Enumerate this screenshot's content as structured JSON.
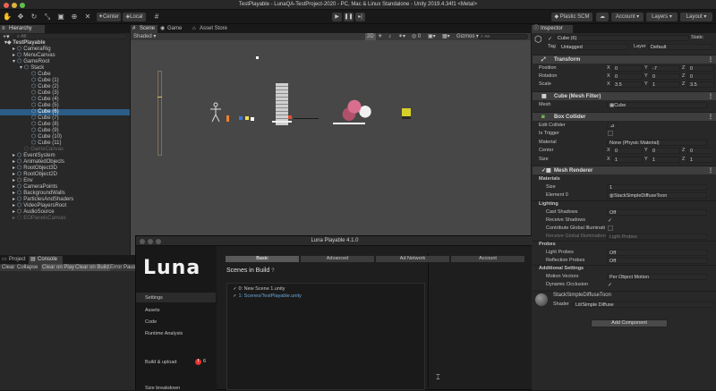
{
  "window": {
    "title": "TestPlayable - LunaQA-TestProject-2020 - PC, Mac & Linux Standalone - Unity 2019.4.34f1 <Metal>"
  },
  "toolbar": {
    "pivot_label": "Center",
    "space_label": "Local",
    "plastic_label": "Plastic SCM",
    "account_label": "Account",
    "layers_label": "Layers",
    "layout_label": "Layout"
  },
  "hierarchy": {
    "tab_label": "Hierarchy",
    "search_placeholder": "All",
    "root": "TestPlayable",
    "items": [
      {
        "label": "CameraRig",
        "indent": 1,
        "state": "normal"
      },
      {
        "label": "MenuCanvas",
        "indent": 1,
        "state": "normal"
      },
      {
        "label": "GameRoot",
        "indent": 1,
        "state": "normal"
      },
      {
        "label": "Stack",
        "indent": 2,
        "state": "normal"
      },
      {
        "label": "Cube",
        "indent": 3,
        "state": "normal"
      },
      {
        "label": "Cube (1)",
        "indent": 3,
        "state": "normal"
      },
      {
        "label": "Cube (2)",
        "indent": 3,
        "state": "normal"
      },
      {
        "label": "Cube (3)",
        "indent": 3,
        "state": "normal"
      },
      {
        "label": "Cube (4)",
        "indent": 3,
        "state": "normal"
      },
      {
        "label": "Cube (5)",
        "indent": 3,
        "state": "normal"
      },
      {
        "label": "Cube (6)",
        "indent": 3,
        "state": "selected"
      },
      {
        "label": "Cube (7)",
        "indent": 3,
        "state": "normal"
      },
      {
        "label": "Cube (8)",
        "indent": 3,
        "state": "normal"
      },
      {
        "label": "Cube (9)",
        "indent": 3,
        "state": "normal"
      },
      {
        "label": "Cube (10)",
        "indent": 3,
        "state": "normal"
      },
      {
        "label": "Cube (11)",
        "indent": 3,
        "state": "normal"
      },
      {
        "label": "GameCanvas",
        "indent": 2,
        "state": "dim"
      },
      {
        "label": "EventSystem",
        "indent": 1,
        "state": "normal"
      },
      {
        "label": "AnimatedObjects",
        "indent": 1,
        "state": "normal"
      },
      {
        "label": "RootObject3D",
        "indent": 1,
        "state": "normal"
      },
      {
        "label": "RootObject2D",
        "indent": 1,
        "state": "normal"
      },
      {
        "label": "Env",
        "indent": 1,
        "state": "normal"
      },
      {
        "label": "CameraPoints",
        "indent": 1,
        "state": "normal"
      },
      {
        "label": "BackgroundWalls",
        "indent": 1,
        "state": "normal"
      },
      {
        "label": "ParticlesAndShaders",
        "indent": 1,
        "state": "normal"
      },
      {
        "label": "VideoPlayersRoot",
        "indent": 1,
        "state": "normal"
      },
      {
        "label": "AudioSource",
        "indent": 1,
        "state": "normal"
      },
      {
        "label": "EOPanelsCanvas",
        "indent": 1,
        "state": "dim"
      }
    ]
  },
  "scene": {
    "tabs": [
      "Scene",
      "Game",
      "Asset Store"
    ],
    "shading": "Shaded",
    "mode": "2D",
    "gizmos": "Gizmos",
    "search_placeholder": "All"
  },
  "console": {
    "tabs": [
      "Project",
      "Console"
    ],
    "buttons": [
      "Clear",
      "Collapse",
      "Clear on Play",
      "Clear on Build",
      "Error Pause"
    ]
  },
  "luna": {
    "title": "Luna Playable 4.1.0",
    "logo": "Luna",
    "tabs": [
      "Basic",
      "Advanced",
      "Ad Network",
      "Account"
    ],
    "nav": [
      "Settings",
      "Assets",
      "Code",
      "Runtime Analysis",
      "Build & upload",
      "Size breakdown"
    ],
    "build_badge": "!",
    "build_count": "6",
    "scenes_heading": "Scenes in Build",
    "scenes": [
      "0: New Scene 1.unity",
      "1: Scenes/TestPlayable.unity"
    ]
  },
  "inspector": {
    "tab_label": "Inspector",
    "object_name": "Cube (6)",
    "static_label": "Static",
    "tag_label": "Tag",
    "tag_value": "Untagged",
    "layer_label": "Layer",
    "layer_value": "Default",
    "transform": {
      "title": "Transform",
      "rows": [
        {
          "label": "Position",
          "x": "0",
          "y": "-7",
          "z": "0"
        },
        {
          "label": "Rotation",
          "x": "0",
          "y": "0",
          "z": "0"
        },
        {
          "label": "Scale",
          "x": "3.5",
          "y": "1",
          "z": "3.5"
        }
      ]
    },
    "mesh_filter": {
      "title": "Cube (Mesh Filter)",
      "mesh_label": "Mesh",
      "mesh_value": "Cube"
    },
    "box_collider": {
      "title": "Box Collider",
      "edit_label": "Edit Collider",
      "trigger_label": "Is Trigger",
      "material_label": "Material",
      "material_value": "None (Physic Material)",
      "center_label": "Center",
      "center": {
        "x": "0",
        "y": "0",
        "z": "0"
      },
      "size_label": "Size",
      "size": {
        "x": "1",
        "y": "1",
        "z": "1"
      }
    },
    "mesh_renderer": {
      "title": "Mesh Renderer",
      "materials_label": "Materials",
      "size_label": "Size",
      "size_value": "1",
      "element_label": "Element 0",
      "element_value": "StackSimpleDiffuseToon",
      "lighting_label": "Lighting",
      "cast_label": "Cast Shadows",
      "cast_value": "Off",
      "receive_label": "Receive Shadows",
      "contrib_label": "Contribute Global Illuminati",
      "receive_gi_label": "Receive Global Illumination",
      "receive_gi_value": "Light Probes",
      "probes_label": "Probes",
      "light_probes_label": "Light Probes",
      "light_probes_value": "Off",
      "refl_label": "Reflection Probes",
      "refl_value": "Off",
      "additional_label": "Additional Settings",
      "motion_label": "Motion Vectors",
      "motion_value": "Per Object Motion",
      "occlusion_label": "Dynamic Occlusion"
    },
    "material": {
      "name": "StackSimpleDiffuseToon",
      "shader_label": "Shader",
      "shader_value": "Lit/Simple Diffuse"
    },
    "add_component": "Add Component"
  },
  "colors": {
    "selection": "#2c5d87",
    "panel": "#282828",
    "scene_bg": "#474747",
    "luna_badge": "#e0352b"
  }
}
